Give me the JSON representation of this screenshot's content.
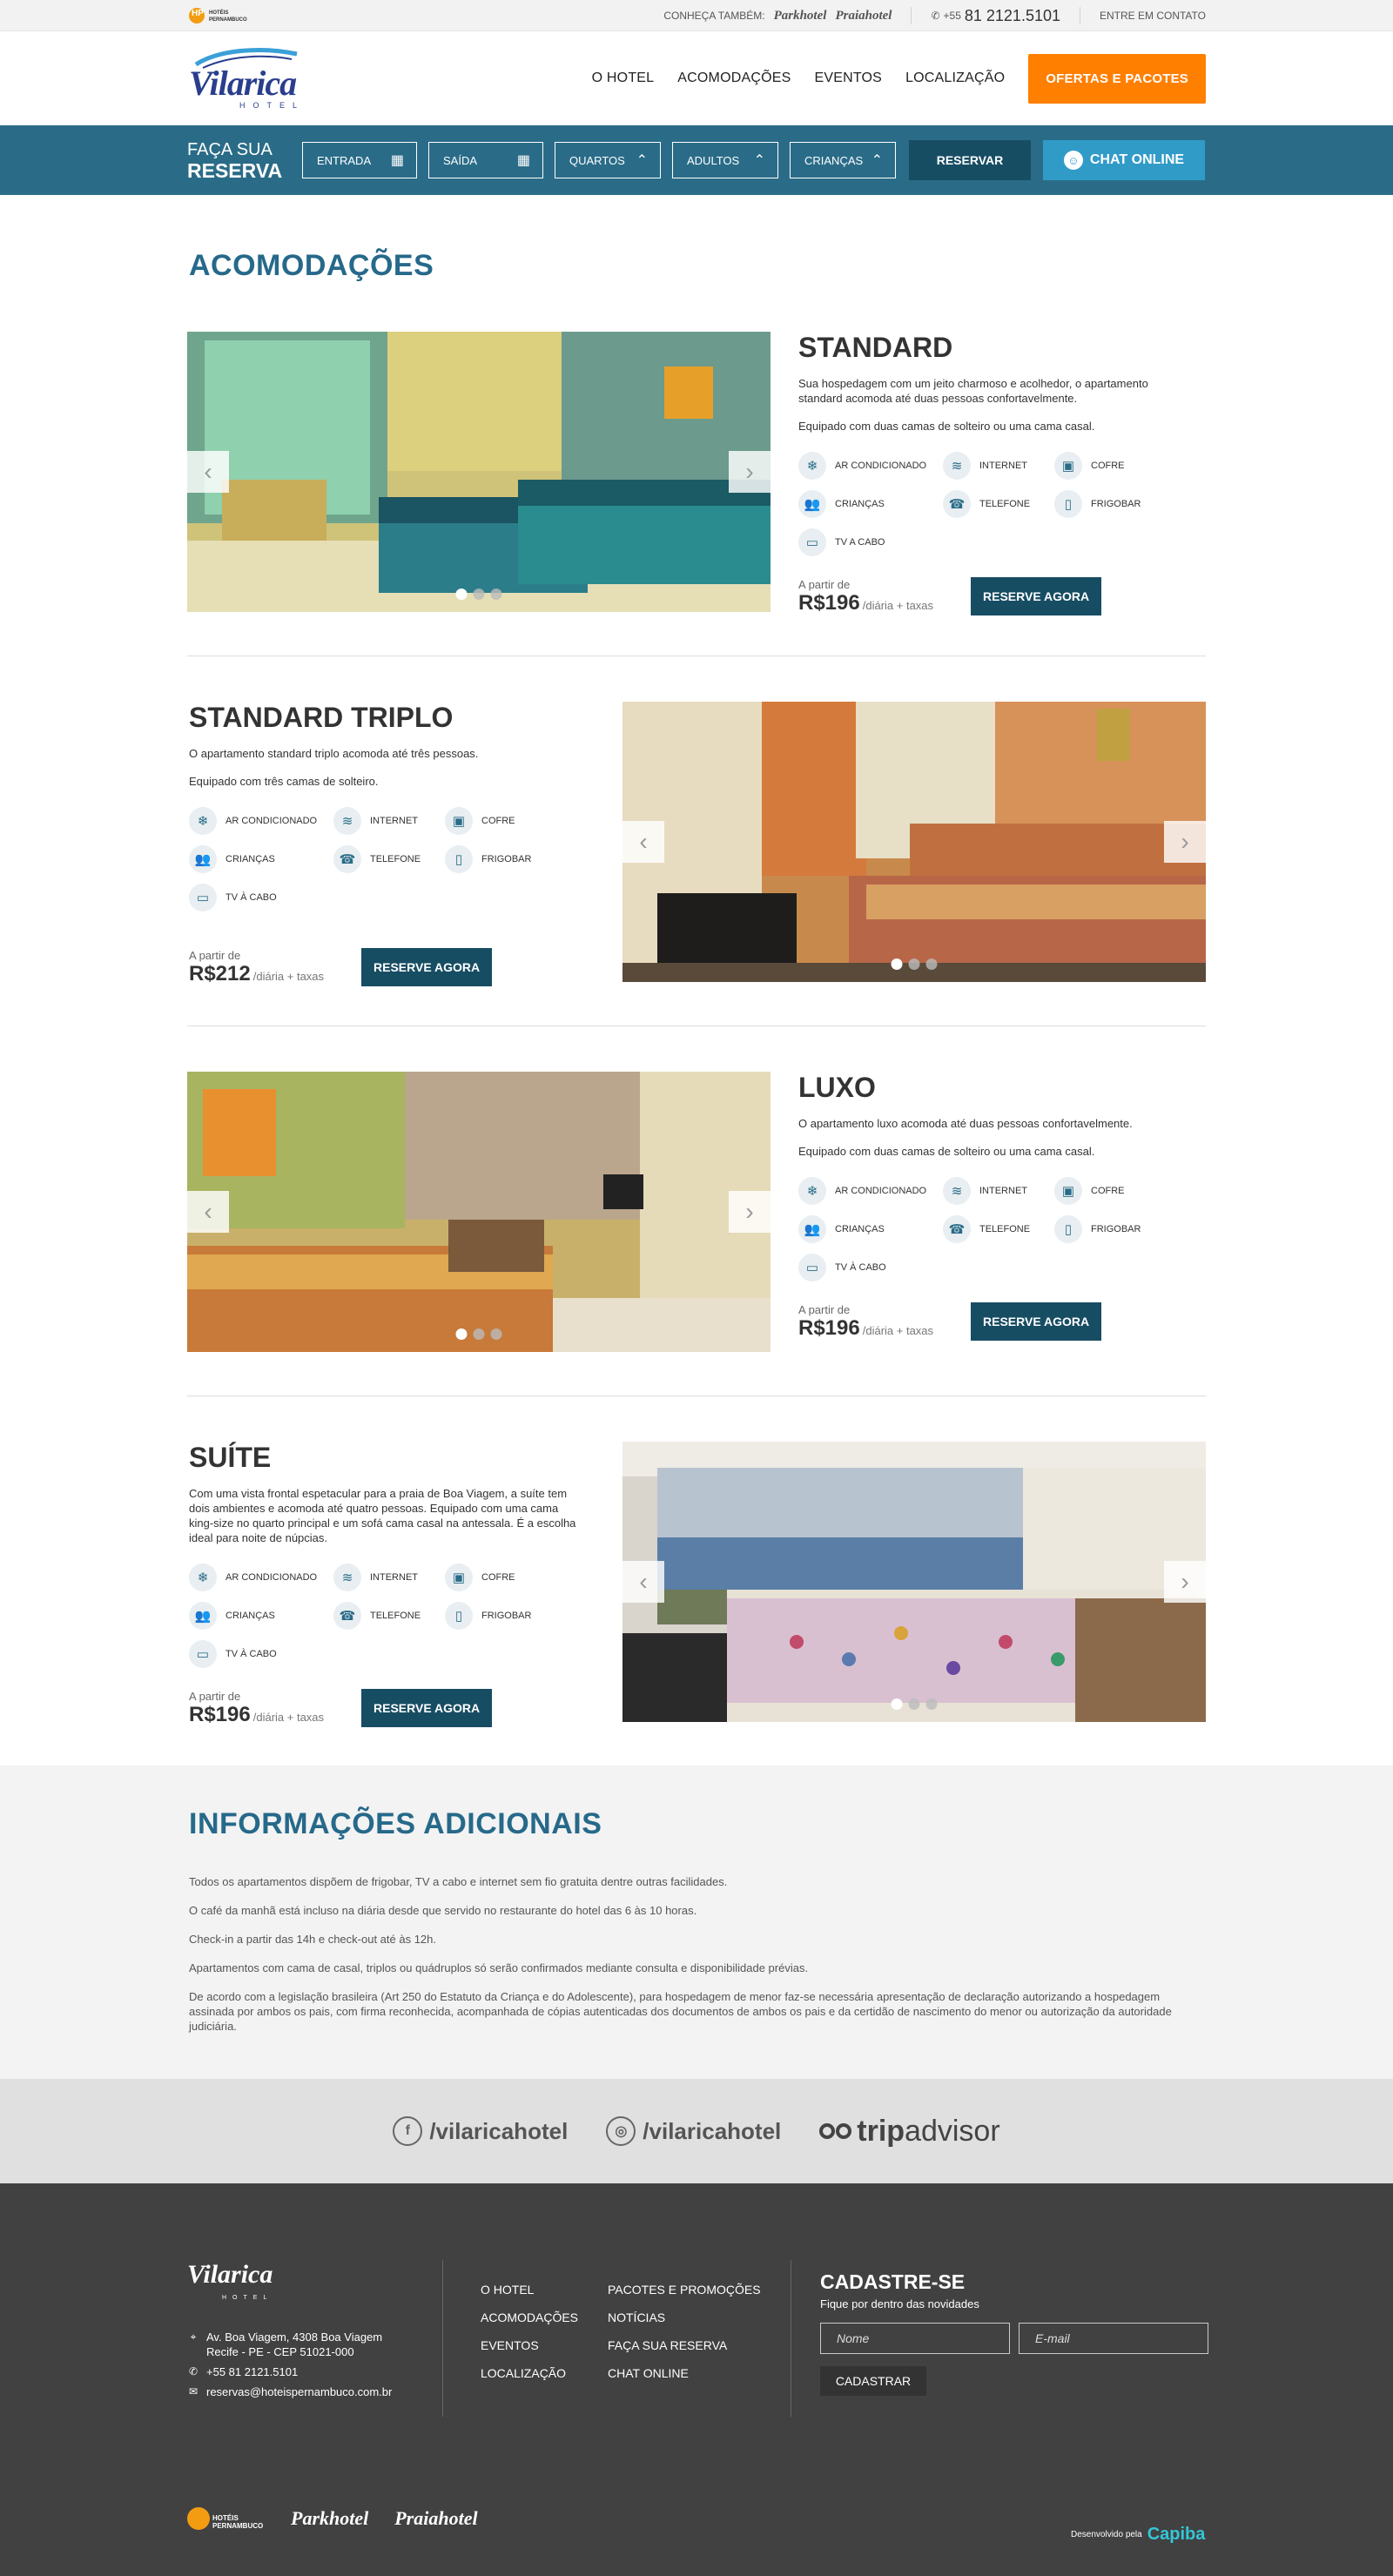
{
  "topbar": {
    "logo_text": "HOTÉIS PERNAMBUCO",
    "conheca": "CONHEÇA TAMBÉM:",
    "brand1": "Parkhotel",
    "brand2": "Praiahotel",
    "phone_prefix": "+55",
    "phone": "81 2121.5101",
    "contact": "ENTRE EM CONTATO"
  },
  "header": {
    "logo_word": "Vilarica",
    "logo_sub": "HOTEL",
    "nav": [
      "O HOTEL",
      "ACOMODAÇÕES",
      "EVENTOS",
      "LOCALIZAÇÃO"
    ],
    "cta": "OFERTAS E PACOTES"
  },
  "booking": {
    "title_a": "FAÇA SUA",
    "title_b": "RESERVA",
    "entrada": "ENTRADA",
    "saida": "SAÍDA",
    "quartos": "QUARTOS",
    "adultos": "ADULTOS",
    "criancas": "CRIANÇAS",
    "reservar": "RESERVAR",
    "chat": "CHAT ONLINE"
  },
  "acomodacoes_title": "ACOMODAÇÕES",
  "amenities": [
    "AR CONDICIONADO",
    "INTERNET",
    "COFRE",
    "CRIANÇAS",
    "TELEFONE",
    "FRIGOBAR"
  ],
  "rooms": [
    {
      "name": "STANDARD",
      "desc": "Sua hospedagem com um jeito charmoso e acolhedor, o apartamento standard acomoda até duas pessoas confortavelmente.",
      "equip": "Equipado com duas camas de solteiro ou uma cama casal.",
      "tv": "TV A CABO",
      "from": "A partir de",
      "price": "R$196",
      "per": "/diária + taxas",
      "button": "RESERVE AGORA"
    },
    {
      "name": "STANDARD TRIPLO",
      "desc": "O apartamento standard triplo acomoda até três pessoas.",
      "equip": "Equipado com três camas de solteiro.",
      "tv": "TV À CABO",
      "from": "A partir de",
      "price": "R$212",
      "per": "/diária + taxas",
      "button": "RESERVE AGORA"
    },
    {
      "name": "LUXO",
      "desc": "O apartamento luxo acomoda até duas pessoas confortavelmente.",
      "equip": "Equipado com duas camas de solteiro ou uma cama casal.",
      "tv": "TV À CABO",
      "from": "A partir de",
      "price": "R$196",
      "per": "/diária + taxas",
      "button": "RESERVE AGORA"
    },
    {
      "name": "SUÍTE",
      "desc": "Com uma vista frontal espetacular para a praia de Boa Viagem, a suíte tem dois ambientes e acomoda até quatro pessoas. Equipado com uma cama king-size no quarto principal e um sofá cama casal na antessala. É a escolha ideal para noite de núpcias.",
      "equip": "",
      "tv": "TV À CABO",
      "from": "A partir de",
      "price": "R$196",
      "per": "/diária + taxas",
      "button": "RESERVE AGORA"
    }
  ],
  "additional": {
    "title": "INFORMAÇÕES ADICIONAIS",
    "paragraphs": [
      "Todos os apartamentos dispõem de frigobar, TV a cabo e internet sem fio gratuita dentre outras facilidades.",
      "O café da manhã está incluso na diária desde que servido no restaurante do hotel das 6 às 10 horas.",
      "Check-in a partir das 14h e check-out até às 12h.",
      "Apartamentos com cama de casal, triplos ou quádruplos só serão confirmados mediante consulta e disponibilidade prévias.",
      "De acordo com a legislação brasileira (Art 250 do Estatuto da Criança e do Adolescente), para hospedagem de menor faz-se necessária apresentação de declaração autorizando a hospedagem assinada por ambos os pais, com firma reconhecida, acompanhada de cópias autenticadas dos documentos de ambos os pais e da certidão de nascimento do menor ou autorização da autoridade judiciária."
    ]
  },
  "social": {
    "facebook": "/vilaricahotel",
    "instagram": "/vilaricahotel",
    "trip_a": "trip",
    "trip_b": "advisor"
  },
  "footer": {
    "logo_word": "Vilarica",
    "logo_sub": "HOTEL",
    "address1": "Av. Boa Viagem, 4308 Boa Viagem",
    "address2": "Recife - PE - CEP 51021-000",
    "phone": "+55 81 2121.5101",
    "email": "reservas@hoteispernambuco.com.br",
    "links": [
      "O HOTEL",
      "PACOTES E PROMOÇÕES",
      "ACOMODAÇÕES",
      "NOTÍCIAS",
      "EVENTOS",
      "FAÇA SUA RESERVA",
      "LOCALIZAÇÃO",
      "CHAT ONLINE"
    ],
    "news_title": "CADASTRE-SE",
    "news_sub": "Fique por dentro das novidades",
    "name_ph": "Nome",
    "email_ph": "E-mail",
    "submit": "CADASTRAR",
    "b1": "HOTÉIS PERNAMBUCO",
    "b2": "Parkhotel",
    "b3": "Praiahotel",
    "dev": "Desenvolvido pela",
    "dev_brand": "Capiba"
  }
}
